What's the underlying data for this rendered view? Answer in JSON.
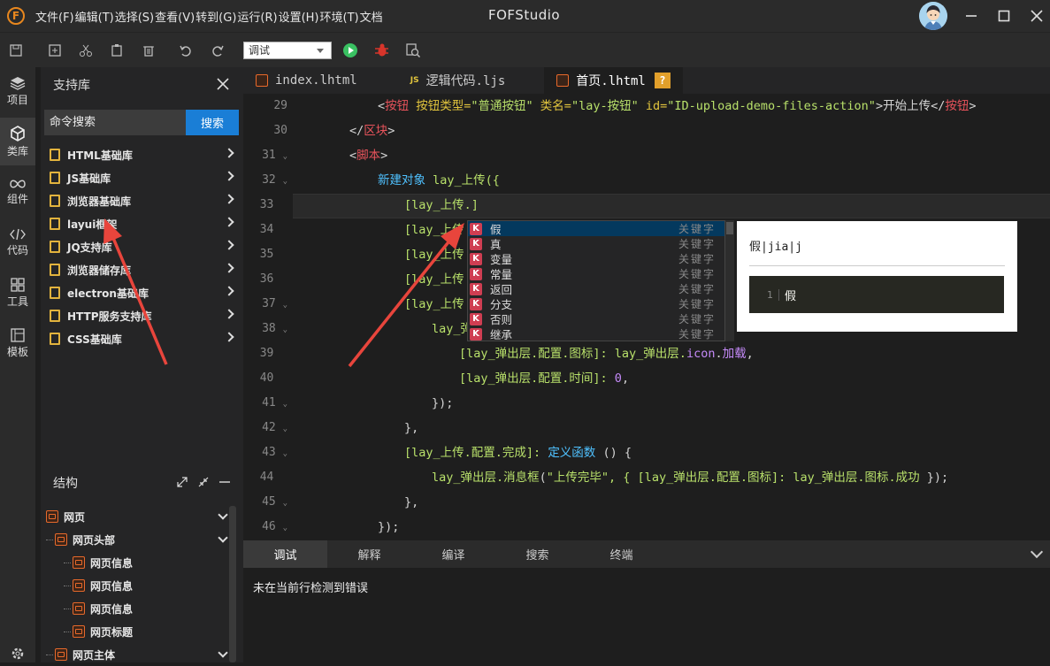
{
  "window": {
    "menu": [
      "文件(F)",
      "编辑(T)",
      "选择(S)",
      "查看(V)",
      "转到(G)",
      "运行(R)",
      "设置(H)",
      "环境(T)",
      "文档"
    ],
    "title": "FOFStudio",
    "logo_text": "F"
  },
  "toolbar": {
    "mode_select_value": "调试",
    "icons": [
      "save-icon",
      "new-file-icon",
      "cut-icon",
      "paste-icon",
      "delete-icon",
      "undo-icon",
      "redo-icon",
      "run-icon",
      "debug-icon",
      "find-icon"
    ]
  },
  "leftbar": [
    {
      "label": "项目",
      "icon": "layers-icon"
    },
    {
      "label": "类库",
      "icon": "cube-icon"
    },
    {
      "label": "组件",
      "icon": "infinity-icon"
    },
    {
      "label": "代码",
      "icon": "code-icon"
    },
    {
      "label": "工具",
      "icon": "tools-icon"
    },
    {
      "label": "模板",
      "icon": "template-icon"
    }
  ],
  "library": {
    "title": "支持库",
    "search_placeholder": "命令搜索",
    "search_button": "搜索",
    "items": [
      "HTML基础库",
      "JS基础库",
      "浏览器基础库",
      "layui框架",
      "JQ支持库",
      "浏览器储存库",
      "electron基础库",
      "HTTP服务支持库",
      "CSS基础库"
    ]
  },
  "structure": {
    "title": "结构",
    "nodes": [
      "网页",
      "网页头部",
      "网页信息",
      "网页信息",
      "网页信息",
      "网页标题",
      "网页主体"
    ]
  },
  "tabs": [
    {
      "label": "index.lhtml"
    },
    {
      "label": "逻辑代码.ljs",
      "badge": "JS"
    },
    {
      "label": "首页.lhtml",
      "badge": "?"
    }
  ],
  "code": {
    "line_numbers": [
      "29",
      "30",
      "31",
      "32",
      "33",
      "34",
      "35",
      "36",
      "37",
      "38",
      "39",
      "40",
      "41",
      "42",
      "43",
      "44",
      "45",
      "46"
    ],
    "fold_marker": "⌄",
    "lines": {
      "l29": [
        "<",
        "按钮",
        " 按钮类型=",
        "\"普通按钮\"",
        " 类名=",
        "\"lay-按钮\"",
        " id=",
        "\"ID-upload-demo-files-action\"",
        ">开始上传</",
        "按钮",
        ">"
      ],
      "l30": [
        "</",
        "区块",
        ">"
      ],
      "l31": [
        "<",
        "脚本",
        ">"
      ],
      "l32": [
        "新建对象",
        " lay_上传({"
      ],
      "l33": "[lay_上传.]",
      "l34": "[lay_上传",
      "l35": "[lay_上传",
      "l36": "[lay_上传",
      "l37": "[lay_上传",
      "l38": "lay_弹",
      "l39": [
        "[lay_弹出层.配置.",
        "图标",
        "]: lay_弹出层.",
        "icon",
        ".",
        "加载",
        ","
      ],
      "l40": [
        "[lay_弹出层.配置.",
        "时间",
        "]: ",
        "0",
        ","
      ],
      "l41": "});",
      "l42": "},",
      "l43": [
        "[lay_上传.",
        "配置",
        ".",
        "完成",
        "]: ",
        "定义函数",
        " () {"
      ],
      "l44": [
        "lay_弹出层.",
        "消息框",
        "(",
        "\"上传完毕\"",
        ", { [lay_弹出层.",
        "配置",
        ".",
        "图标",
        "]: lay_弹出层.",
        "图标",
        ".",
        "成功",
        " });"
      ],
      "l45": "},",
      "l46": "});"
    }
  },
  "autocomplete": {
    "items": [
      {
        "kind": "K",
        "label": "假",
        "type": "关键字"
      },
      {
        "kind": "K",
        "label": "真",
        "type": "关键字"
      },
      {
        "kind": "K",
        "label": "变量",
        "type": "关键字"
      },
      {
        "kind": "K",
        "label": "常量",
        "type": "关键字"
      },
      {
        "kind": "K",
        "label": "返回",
        "type": "关键字"
      },
      {
        "kind": "K",
        "label": "分支",
        "type": "关键字"
      },
      {
        "kind": "K",
        "label": "否则",
        "type": "关键字"
      },
      {
        "kind": "K",
        "label": "继承",
        "type": "关键字"
      }
    ],
    "doc_title": "假|jia|j",
    "doc_line_number": "1",
    "doc_code": "假"
  },
  "bottom": {
    "tabs": [
      "调试",
      "解释",
      "编译",
      "搜索",
      "终端"
    ],
    "message": "未在当前行检测到错误"
  },
  "colors": {
    "accent": "#1a7ed6",
    "keyword_badge": "#cf3e52",
    "annotation_arrow": "#e8453c"
  }
}
